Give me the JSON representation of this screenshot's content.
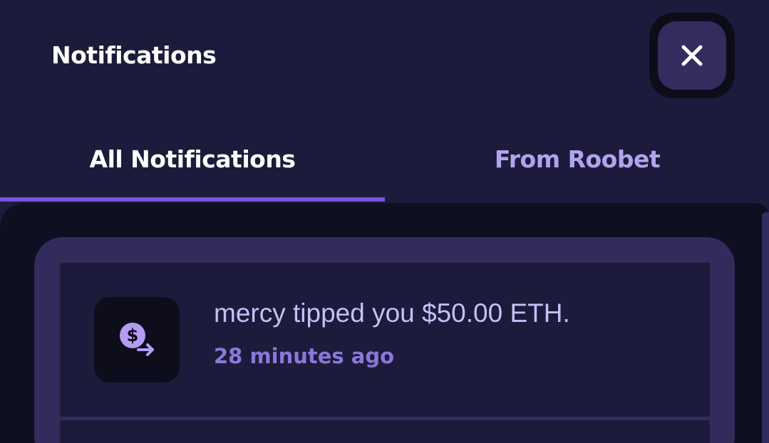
{
  "header": {
    "title": "Notifications",
    "close_icon": "close-icon"
  },
  "tabs": [
    {
      "label": "All Notifications",
      "active": true
    },
    {
      "label": "From Roobet",
      "active": false
    }
  ],
  "notifications": [
    {
      "icon": "dollar-transfer-icon",
      "message": "mercy tipped you $50.00 ETH.",
      "time": "28 minutes ago"
    }
  ],
  "colors": {
    "background": "#1c1b3b",
    "accent": "#7b4fe0",
    "inactive_tab": "#b3a3ee",
    "message_text": "#c8bef6",
    "time_text": "#8a78d8"
  }
}
